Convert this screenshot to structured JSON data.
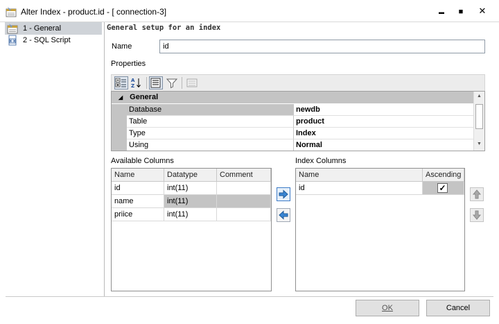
{
  "window": {
    "title": "Alter Index - product.id - [ connection-3]",
    "min": "▬",
    "max": "■",
    "close": "✕"
  },
  "sidebar": {
    "items": [
      {
        "label": "1 - General",
        "selected": true
      },
      {
        "label": "2 - SQL Script",
        "selected": false
      }
    ]
  },
  "main": {
    "section_title": "General setup for an index",
    "name_label": "Name",
    "name_value": "id",
    "properties_label": "Properties",
    "properties": {
      "category": "General",
      "rows": [
        {
          "name": "Database",
          "value": "newdb"
        },
        {
          "name": "Table",
          "value": "product"
        },
        {
          "name": "Type",
          "value": "Index"
        },
        {
          "name": "Using",
          "value": "Normal"
        }
      ]
    },
    "available": {
      "label": "Available Columns",
      "headers": [
        "Name",
        "Datatype",
        "Comment"
      ],
      "rows": [
        {
          "name": "id",
          "datatype": "int(11)",
          "comment": ""
        },
        {
          "name": "name",
          "datatype": "int(11)",
          "comment": ""
        },
        {
          "name": "priice",
          "datatype": "int(11)",
          "comment": ""
        }
      ]
    },
    "index_columns": {
      "label": "Index Columns",
      "headers": [
        "Name",
        "Ascending"
      ],
      "rows": [
        {
          "name": "id",
          "ascending": "✓"
        }
      ]
    }
  },
  "footer": {
    "ok": "OK",
    "cancel": "Cancel"
  }
}
